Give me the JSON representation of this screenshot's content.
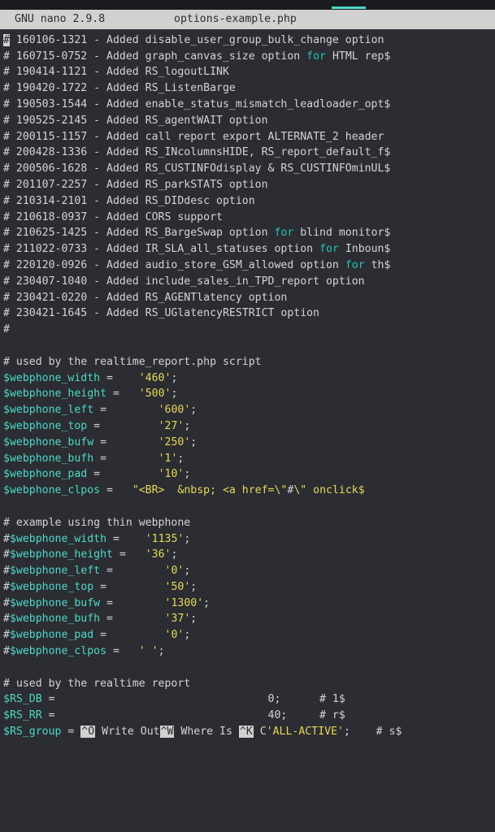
{
  "titlebar": {
    "app": "GNU nano 2.9.8",
    "filename": "options-example.php"
  },
  "changelog": [
    "# 160106-1321 - Added disable_user_group_bulk_change option",
    "# 160715-0752 - Added graph_canvas_size option |for| HTML rep$",
    "# 190414-1121 - Added RS_logoutLINK",
    "# 190420-1722 - Added RS_ListenBarge",
    "# 190503-1544 - Added enable_status_mismatch_leadloader_opt$",
    "# 190525-2145 - Added RS_agentWAIT option",
    "# 200115-1157 - Added call report export ALTERNATE_2 header",
    "# 200428-1336 - Added RS_INcolumnsHIDE, RS_report_default_f$",
    "# 200506-1628 - Added RS_CUSTINFOdisplay & RS_CUSTINFOminUL$",
    "# 201107-2257 - Added RS_parkSTATS option",
    "# 210314-2101 - Added RS_DIDdesc option",
    "# 210618-0937 - Added CORS support",
    "# 210625-1425 - Added RS_BargeSwap option |for| blind monitor$",
    "# 211022-0733 - Added IR_SLA_all_statuses option |for| Inboun$",
    "# 220120-0926 - Added audio_store_GSM_allowed option |for| th$",
    "# 230407-1040 - Added include_sales_in_TPD_report option",
    "# 230421-0220 - Added RS_AGENTlatency option",
    "# 230421-1645 - Added RS_UGlatencyRESTRICT option",
    "#"
  ],
  "section1": {
    "comment": "# used by the realtime_report.php script",
    "vars": [
      {
        "name": "$webphone_width",
        "pad": " =    ",
        "val": "'460'"
      },
      {
        "name": "$webphone_height",
        "pad": " =   ",
        "val": "'500'"
      },
      {
        "name": "$webphone_left",
        "pad": " =        ",
        "val": "'600'"
      },
      {
        "name": "$webphone_top",
        "pad": " =         ",
        "val": "'27'"
      },
      {
        "name": "$webphone_bufw",
        "pad": " =        ",
        "val": "'250'"
      },
      {
        "name": "$webphone_bufh",
        "pad": " =        ",
        "val": "'1'"
      },
      {
        "name": "$webphone_pad",
        "pad": " =         ",
        "val": "'10'"
      },
      {
        "name": "$webphone_clpos",
        "pad": " =   ",
        "val": "\"<BR>  &nbsp; <a href=\\\"",
        "tail1": "#",
        "tail2": "\\\" onclick$"
      }
    ]
  },
  "section2": {
    "comment": "# example using thin webphone",
    "vars": [
      {
        "prefix": "#",
        "name": "$webphone_width",
        "pad": " =    ",
        "val": "'1135'"
      },
      {
        "prefix": "#",
        "name": "$webphone_height",
        "pad": " =   ",
        "val": "'36'"
      },
      {
        "prefix": "#",
        "name": "$webphone_left",
        "pad": " =        ",
        "val": "'0'"
      },
      {
        "prefix": "#",
        "name": "$webphone_top",
        "pad": " =         ",
        "val": "'50'"
      },
      {
        "prefix": "#",
        "name": "$webphone_bufw",
        "pad": " =        ",
        "val": "'1300'"
      },
      {
        "prefix": "#",
        "name": "$webphone_bufh",
        "pad": " =        ",
        "val": "'37'"
      },
      {
        "prefix": "#",
        "name": "$webphone_pad",
        "pad": " =         ",
        "val": "'0'"
      },
      {
        "prefix": "#",
        "name": "$webphone_clpos",
        "pad": " =   ",
        "val": "' '"
      }
    ]
  },
  "section3": {
    "comment": "# used by the realtime report",
    "lines": [
      {
        "name": "$RS_DB",
        "pad": " =                                 ",
        "num": "0;",
        "trail": "      # 1$"
      },
      {
        "name": "$RS_RR",
        "pad": " =                                 ",
        "num": "40;",
        "trail": "     # r$"
      }
    ]
  },
  "footer": {
    "var": "$RS_group",
    "eq": " = ",
    "k1": "^O",
    "t1": " Write Out",
    "k2": "^W",
    "t2": " Where Is ",
    "k3": "^K",
    "t3": " C",
    "val": "'ALL-ACTIVE'",
    "end": ";    # s$"
  }
}
